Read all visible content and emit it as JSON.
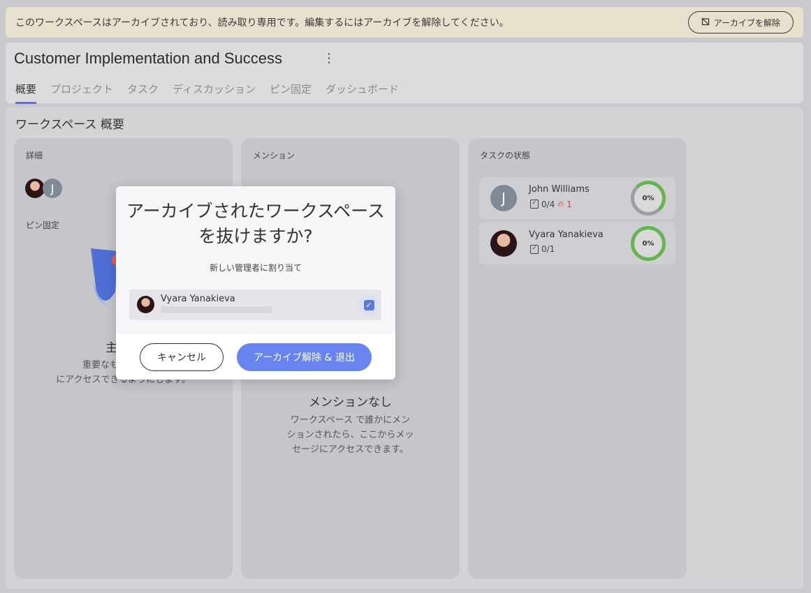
{
  "banner": {
    "message": "このワークスペースはアーカイブされており、読み取り専用です。編集するにはアーカイブを解除してください。",
    "unarchive_label": "アーカイブを解除"
  },
  "workspace": {
    "title": "Customer Implementation and Success",
    "tabs": [
      {
        "label": "概要"
      },
      {
        "label": "プロジェクト"
      },
      {
        "label": "タスク"
      },
      {
        "label": "ディスカッション"
      },
      {
        "label": "ピン固定"
      },
      {
        "label": "ダッシュボード"
      }
    ]
  },
  "overview": {
    "title": "ワークスペース 概要",
    "details": {
      "label": "詳細",
      "member_initial": "J",
      "pinned_label": "ピン固定",
      "empty_title": "主なコ",
      "empty_body_1": "重要なものをここに",
      "empty_body_2": "にアクセスできるようにします。"
    },
    "mentions": {
      "label": "メンション",
      "empty_title": "メンションなし",
      "empty_body_1": "ワークスペース で誰かにメン",
      "empty_body_2": "ションされたら、ここからメッ",
      "empty_body_3": "セージにアクセスできます。"
    },
    "task_status": {
      "label": "タスクの状態",
      "rows": [
        {
          "name": "John Williams",
          "initial": "J",
          "tasks": "0/4",
          "overdue": "1",
          "percent": "0%"
        },
        {
          "name": "Vyara Yanakieva",
          "tasks": "0/1",
          "percent": "0%"
        }
      ]
    }
  },
  "dialog": {
    "title_line1": "アーカイブされたワークスペース",
    "title_line2": "を抜けますか?",
    "subtitle": "新しい管理者に割り当て",
    "assignee_name": "Vyara Yanakieva",
    "cancel_label": "キャンセル",
    "confirm_label": "アーカイブ解除 & 退出"
  },
  "colors": {
    "accent": "#5b6fd6",
    "primary_button": "#6884f0",
    "ring_green": "#64b54d",
    "banner_bg": "#e6e0cd"
  }
}
